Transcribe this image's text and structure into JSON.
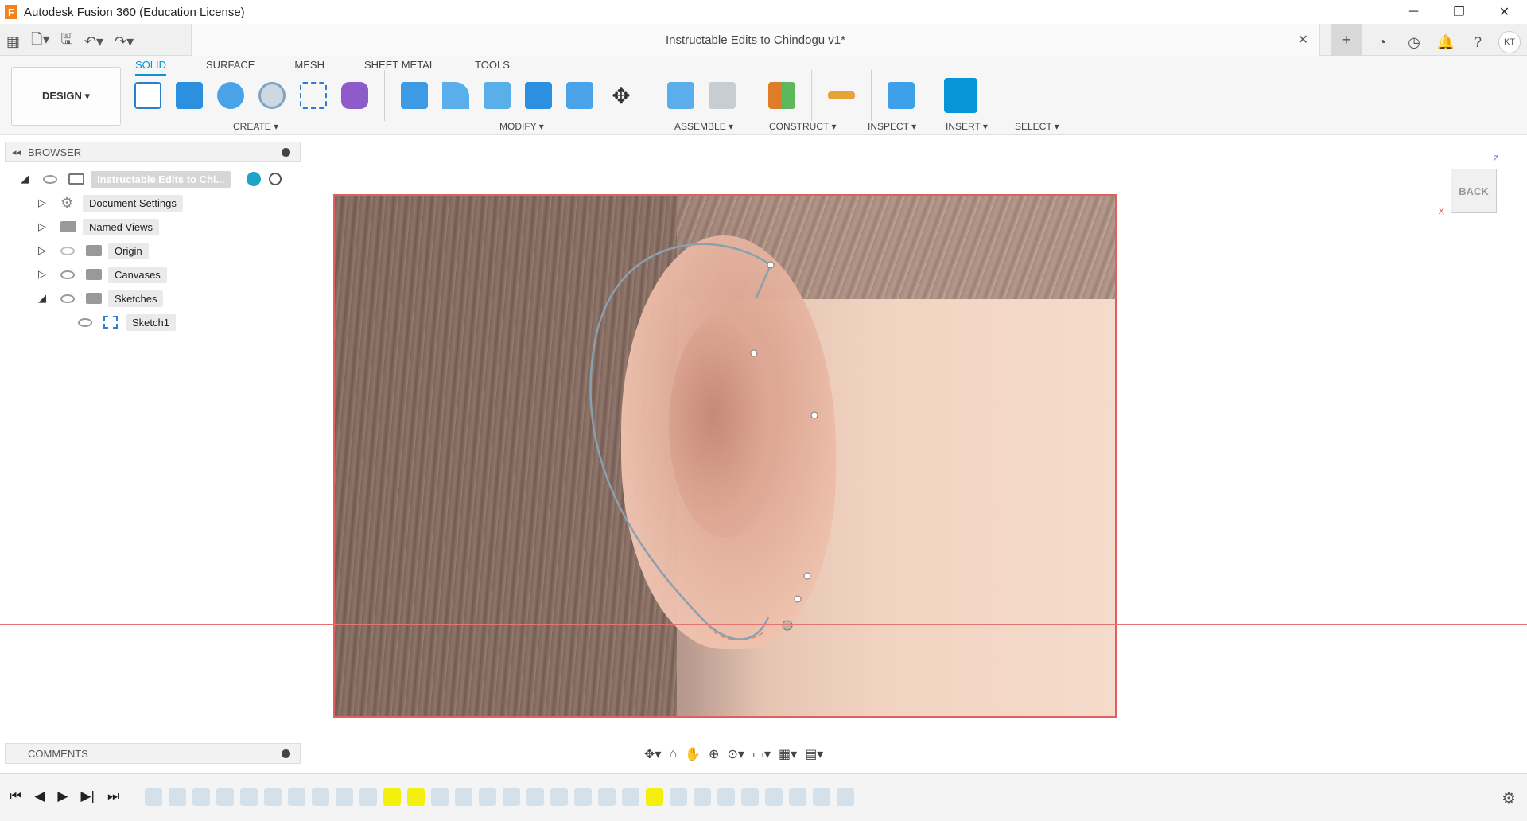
{
  "window": {
    "title": "Autodesk Fusion 360 (Education License)",
    "app_icon_letter": "F",
    "controls": [
      "─",
      "❐",
      "✕"
    ]
  },
  "toolbar": {
    "document_title": "Instructable Edits to Chindogu v1*",
    "close_glyph": "✕",
    "avatar_initials": "KT"
  },
  "ribbon": {
    "workspace_label": "DESIGN ▾",
    "tabs": [
      "SOLID",
      "SURFACE",
      "MESH",
      "SHEET METAL",
      "TOOLS"
    ],
    "active_tab": "SOLID",
    "groups": [
      "CREATE ▾",
      "MODIFY ▾",
      "ASSEMBLE ▾",
      "CONSTRUCT ▾",
      "INSPECT ▾",
      "INSERT ▾",
      "SELECT ▾"
    ]
  },
  "browser": {
    "header": "BROWSER",
    "root": "Instructable Edits to Chi...",
    "items": [
      {
        "label": "Document Settings"
      },
      {
        "label": "Named Views"
      },
      {
        "label": "Origin"
      },
      {
        "label": "Canvases"
      },
      {
        "label": "Sketches"
      },
      {
        "label": "Sketch1"
      }
    ]
  },
  "viewcube": {
    "face": "BACK",
    "axis_z": "Z",
    "axis_x": "X"
  },
  "comments": {
    "header": "COMMENTS"
  }
}
